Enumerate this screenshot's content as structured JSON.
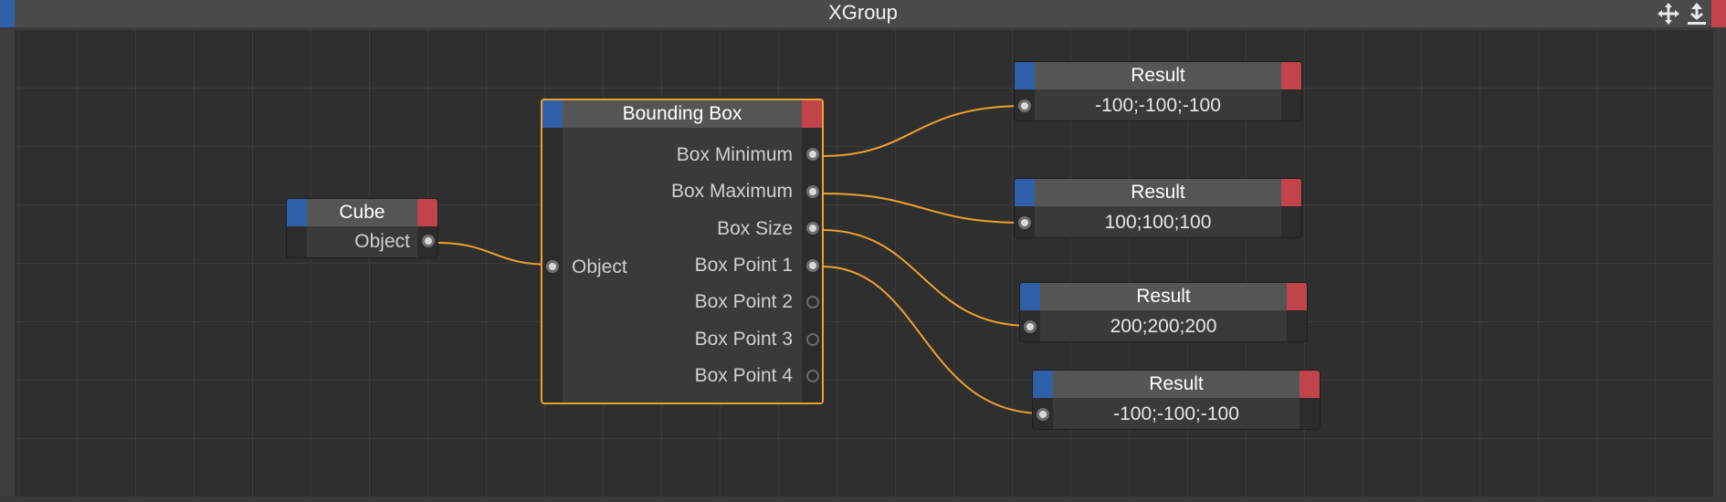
{
  "window": {
    "title": "XGroup",
    "tools": [
      "move-icon",
      "fit-view-icon"
    ]
  },
  "colors": {
    "node_input_tab": "#2f5fa8",
    "node_output_tab": "#c0444a",
    "wire": "#f0a030",
    "selected_outline": "#f0a030"
  },
  "nodes": {
    "cube": {
      "title": "Cube",
      "outputs": [
        "Object"
      ]
    },
    "bounding_box": {
      "title": "Bounding Box",
      "inputs": [
        "Object"
      ],
      "outputs": [
        "Box Minimum",
        "Box Maximum",
        "Box Size",
        "Box Point 1",
        "Box Point 2",
        "Box Point 3",
        "Box Point 4"
      ]
    },
    "results": [
      {
        "title": "Result",
        "value": "-100;-100;-100"
      },
      {
        "title": "Result",
        "value": "100;100;100"
      },
      {
        "title": "Result",
        "value": "200;200;200"
      },
      {
        "title": "Result",
        "value": "-100;-100;-100"
      }
    ]
  }
}
